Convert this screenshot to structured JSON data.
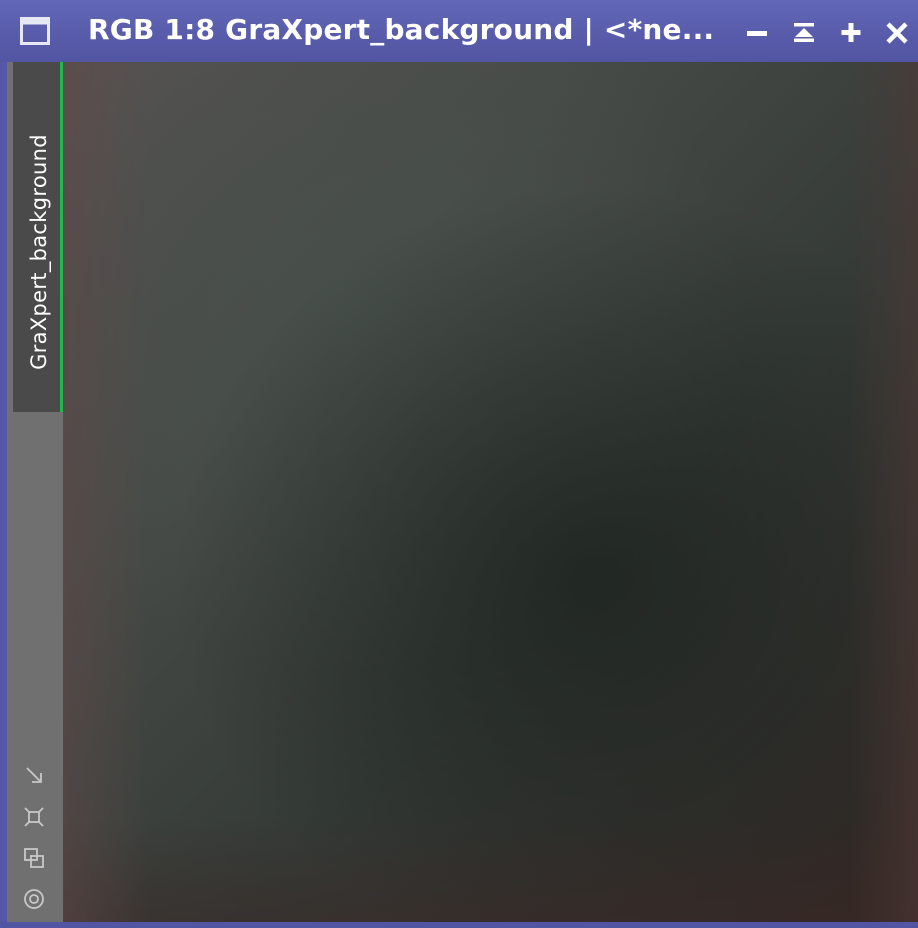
{
  "window": {
    "title": "RGB 1:8 GraXpert_background | <*ne...",
    "icon": "window-icon",
    "buttons": {
      "minimize": "minimize-icon",
      "shade": "shade-icon",
      "maximize": "maximize-icon",
      "close": "close-icon"
    },
    "colors": {
      "titlebar": "#575ba9",
      "tab_accent": "#21b84f",
      "tabstrip": "#707070"
    }
  },
  "tabs": [
    {
      "label": "GraXpert_background",
      "active": true
    }
  ],
  "sidebar_icons": [
    "zoom-to-fit-icon",
    "zoom-actual-icon",
    "clone-icon",
    "target-icon"
  ]
}
